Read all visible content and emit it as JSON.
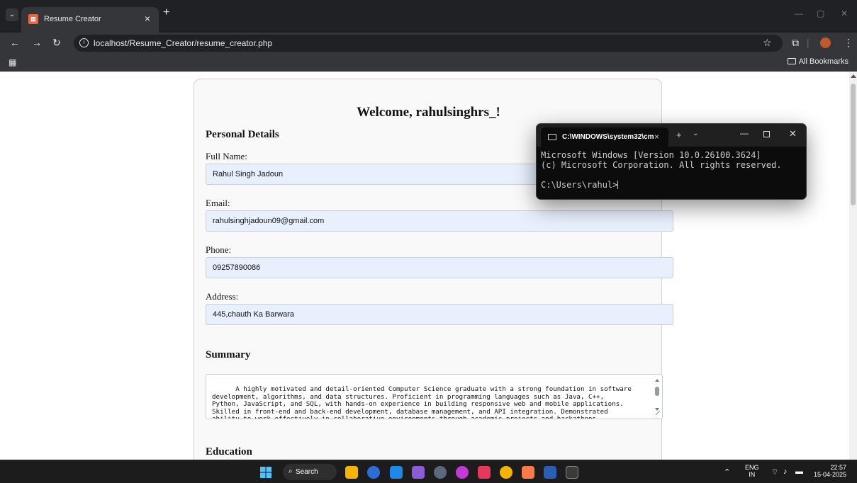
{
  "browser": {
    "tab_title": "Resume Creator",
    "tab_close": "×",
    "new_tab": "+",
    "url": "localhost/Resume_Creator/resume_creator.php",
    "bookmarks_all": "All Bookmarks"
  },
  "page": {
    "welcome": "Welcome, rahulsinghrs_!",
    "personal_heading": "Personal Details",
    "fields": [
      {
        "label": "Full Name:",
        "value": "Rahul Singh Jadoun"
      },
      {
        "label": "Email:",
        "value": "rahulsinghjadoun09@gmail.com"
      },
      {
        "label": "Phone:",
        "value": "09257890086"
      },
      {
        "label": "Address:",
        "value": "445,chauth Ka Barwara"
      }
    ],
    "summary_heading": "Summary",
    "summary_text": "A highly motivated and detail-oriented Computer Science graduate with a strong foundation in software\ndevelopment, algorithms, and data structures. Proficient in programming languages such as Java, C++,\nPython, JavaScript, and SQL, with hands-on experience in building responsive web and mobile applications.\nSkilled in front-end and back-end development, database management, and API integration. Demonstrated\nability to work effectively in collaborative environments through academic projects and hackathons.",
    "education_heading": "Education"
  },
  "terminal": {
    "tab_title": "C:\\WINDOWS\\system32\\cm",
    "close": "×",
    "plus": "+",
    "line1": "Microsoft Windows [Version 10.0.26100.3624]",
    "line2": "(c) Microsoft Corporation. All rights reserved.",
    "prompt": "C:\\Users\\rahul>"
  },
  "taskbar": {
    "search_label": "Search",
    "lang": "ENG",
    "region": "IN",
    "time": "22:57",
    "date": "15-04-2025"
  }
}
